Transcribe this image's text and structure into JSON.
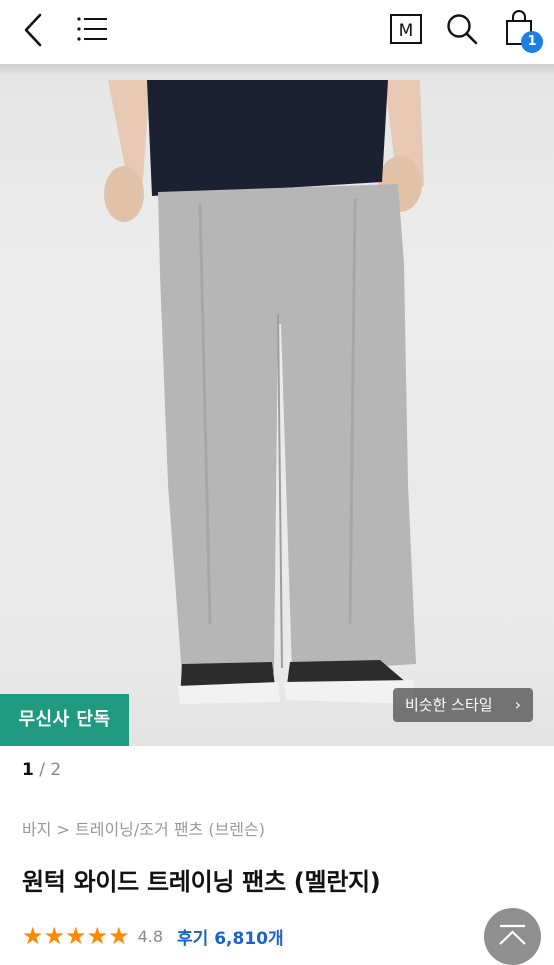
{
  "header": {
    "back_icon": "chevron-left-icon",
    "menu_icon": "hamburger-menu-icon",
    "brand_icon_label": "M",
    "search_icon": "search-icon",
    "cart_icon": "shopping-bag-icon",
    "cart_count": "1"
  },
  "hero": {
    "exclusive_label": "무신사 단독",
    "similar_style_label": "비슷한 스타일",
    "similar_chevron": "›"
  },
  "pager": {
    "current": "1",
    "separator": " / ",
    "total": "2"
  },
  "breadcrumb": "바지 > 트레이닝/조거 팬츠 (브렌슨)",
  "product": {
    "title": "원턱 와이드 트레이닝 팬츠 (멜란지)",
    "rating": "4.8",
    "stars": 5,
    "reviews_label": "후기 6,810개"
  },
  "colors": {
    "accent_green": "#1f9a7e",
    "star": "#ff8a00",
    "link_blue": "#1b63c6",
    "badge_blue": "#1b7fe5"
  }
}
